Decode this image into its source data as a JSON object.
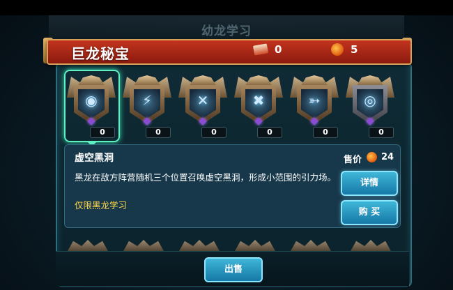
{
  "background": {
    "screen_title": "幼龙学习"
  },
  "header": {
    "title": "巨龙秘宝",
    "scroll_count": "0",
    "coin_count": "5"
  },
  "skills": [
    {
      "icon": "void-orb-icon",
      "glyph": "◉",
      "count": "0"
    },
    {
      "icon": "bolt-heart-icon",
      "glyph": "⚡",
      "count": "0"
    },
    {
      "icon": "crossed-swords-icon",
      "glyph": "✕",
      "count": "0"
    },
    {
      "icon": "shattered-shield-icon",
      "glyph": "✖",
      "count": "0"
    },
    {
      "icon": "wind-arrow-icon",
      "glyph": "➳",
      "count": "0"
    },
    {
      "icon": "ring-icon",
      "glyph": "◎",
      "count": "0"
    }
  ],
  "detail": {
    "name": "虚空黑洞",
    "price_label": "售价",
    "price_value": "24",
    "description": "黑龙在敌方阵营随机三个位置召唤虚空黑洞，形成小范围的引力场。",
    "restriction": "仅限黑龙学习",
    "details_button": "详情",
    "buy_button": "购 买"
  },
  "footer": {
    "sell_button": "出售"
  },
  "colors": {
    "banner": "#b12a17",
    "accent": "#5ff0c4",
    "button": "#2a9fca"
  }
}
